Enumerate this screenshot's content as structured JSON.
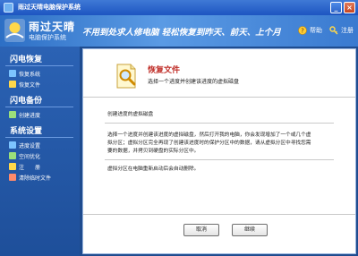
{
  "window": {
    "title": "雨过天晴电脑保护系统",
    "min_label": "_",
    "close_label": "×"
  },
  "header": {
    "logo_name": "雨过天晴",
    "logo_sub": "电脑保护系统",
    "slogan": "不用到处求人修电脑 轻松恢复到昨天、前天、上个月",
    "help_label": "帮助",
    "register_label": "注册"
  },
  "sidebar": {
    "sections": [
      {
        "title": "闪电恢复",
        "items": [
          {
            "label": "恢复系统",
            "icon": "restore-system-icon"
          },
          {
            "label": "恢复文件",
            "icon": "restore-file-icon"
          }
        ]
      },
      {
        "title": "闪电备份",
        "items": [
          {
            "label": "创建进度",
            "icon": "create-progress-icon"
          }
        ]
      },
      {
        "title": "系统设置",
        "items": [
          {
            "label": "进度设置",
            "icon": "progress-settings-icon"
          },
          {
            "label": "空间优化",
            "icon": "space-optimize-icon"
          },
          {
            "label": "注　　册",
            "icon": "register-icon"
          },
          {
            "label": "清除临时文件",
            "icon": "clear-temp-icon"
          }
        ]
      }
    ]
  },
  "wizard": {
    "title": "恢复文件",
    "subtitle": "选择一个进度并创建该进度的虚拟磁盘",
    "section_heading": "创建进度的虚拟磁盘",
    "description_lines": [
      "选择一个进度并创建该进度的虚拟磁盘，然后打开我的电脑，你会发现增加了一个或几个虚",
      "拟分区；虚拟分区完全再现了创建该进度时的保护分区中的数据，请从虚拟分区中寻找您需",
      "要的数据，并拷贝到硬盘的实际分区中。"
    ],
    "note": "虚拟分区在电脑重新启动后会自动删除。",
    "cancel_label": "取消",
    "next_label": "继续"
  },
  "colors": {
    "accent_title": "#c0302a",
    "sidebar_bg": "#2b62b4",
    "titlebar_bg": "#1d55c1"
  }
}
